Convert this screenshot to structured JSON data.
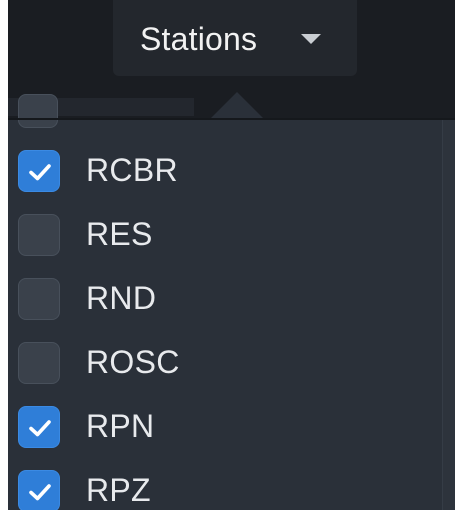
{
  "header": {
    "dropdown_label": "Stations",
    "dropdown_icon": "caret-down-icon"
  },
  "stations": [
    {
      "label": "RCBR",
      "checked": true
    },
    {
      "label": "RES",
      "checked": false
    },
    {
      "label": "RND",
      "checked": false
    },
    {
      "label": "ROSC",
      "checked": false
    },
    {
      "label": "RPN",
      "checked": true
    },
    {
      "label": "RPZ",
      "checked": true
    }
  ],
  "colors": {
    "checked": "#2f7ed8",
    "unchecked": "#3a414b",
    "panel": "#2a3039",
    "toolbar": "#1a1d22"
  }
}
